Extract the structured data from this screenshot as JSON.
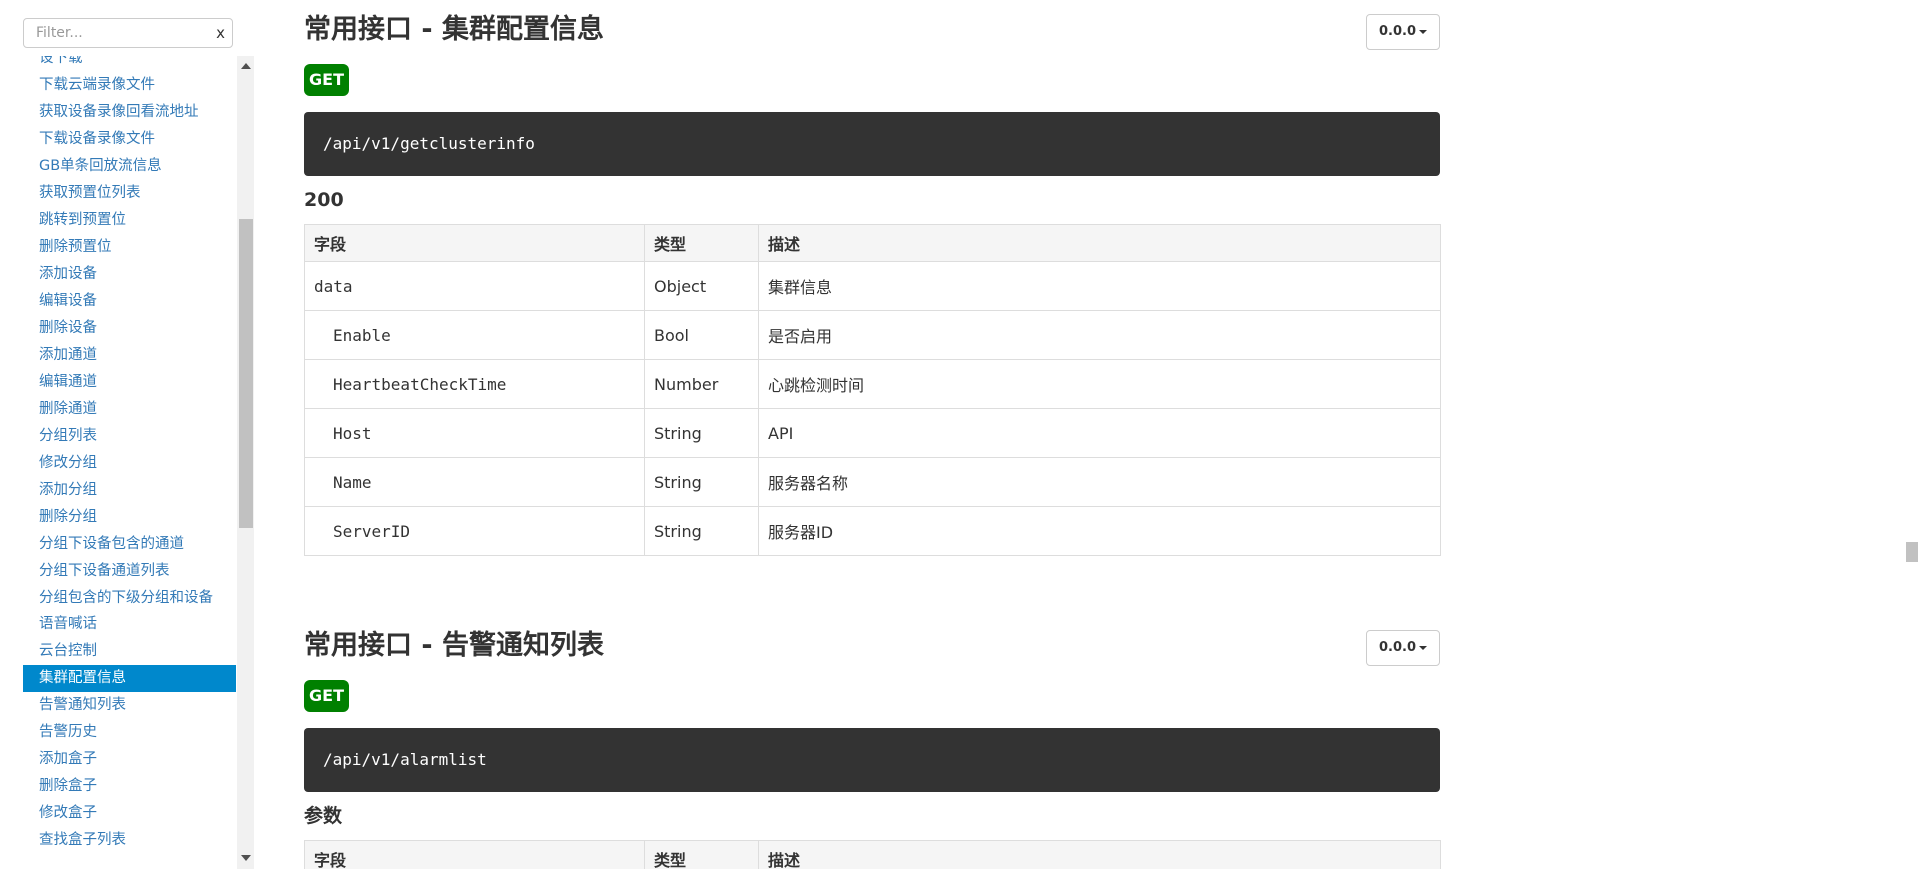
{
  "sidebar": {
    "filter": {
      "placeholder": "Filter...",
      "value": "",
      "clear_label": "x"
    },
    "items": [
      {
        "label": "设下载",
        "active": false
      },
      {
        "label": "下载云端录像文件",
        "active": false
      },
      {
        "label": "获取设备录像回看流地址",
        "active": false
      },
      {
        "label": "下载设备录像文件",
        "active": false
      },
      {
        "label": "GB单条回放流信息",
        "active": false
      },
      {
        "label": "获取预置位列表",
        "active": false
      },
      {
        "label": "跳转到预置位",
        "active": false
      },
      {
        "label": "删除预置位",
        "active": false
      },
      {
        "label": "添加设备",
        "active": false
      },
      {
        "label": "编辑设备",
        "active": false
      },
      {
        "label": "删除设备",
        "active": false
      },
      {
        "label": "添加通道",
        "active": false
      },
      {
        "label": "编辑通道",
        "active": false
      },
      {
        "label": "删除通道",
        "active": false
      },
      {
        "label": "分组列表",
        "active": false
      },
      {
        "label": "修改分组",
        "active": false
      },
      {
        "label": "添加分组",
        "active": false
      },
      {
        "label": "删除分组",
        "active": false
      },
      {
        "label": "分组下设备包含的通道",
        "active": false
      },
      {
        "label": "分组下设备通道列表",
        "active": false
      },
      {
        "label": "分组包含的下级分组和设备",
        "active": false
      },
      {
        "label": "语音喊话",
        "active": false
      },
      {
        "label": "云台控制",
        "active": false
      },
      {
        "label": "集群配置信息",
        "active": true
      },
      {
        "label": "告警通知列表",
        "active": false
      },
      {
        "label": "告警历史",
        "active": false
      },
      {
        "label": "添加盒子",
        "active": false
      },
      {
        "label": "删除盒子",
        "active": false
      },
      {
        "label": "修改盒子",
        "active": false
      },
      {
        "label": "查找盒子列表",
        "active": false
      }
    ]
  },
  "sections": [
    {
      "title": "常用接口 - 集群配置信息",
      "version": "0.0.0",
      "method": "GET",
      "endpoint": "/api/v1/getclusterinfo",
      "subheading": "200",
      "columns": [
        "字段",
        "类型",
        "描述"
      ],
      "rows": [
        {
          "field": "data",
          "type": "Object",
          "desc": "集群信息",
          "nested": false
        },
        {
          "field": "Enable",
          "type": "Bool",
          "desc": "是否启用",
          "nested": true
        },
        {
          "field": "HeartbeatCheckTime",
          "type": "Number",
          "desc": "心跳检测时间",
          "nested": true
        },
        {
          "field": "Host",
          "type": "String",
          "desc": "API",
          "nested": true
        },
        {
          "field": "Name",
          "type": "String",
          "desc": "服务器名称",
          "nested": true
        },
        {
          "field": "ServerID",
          "type": "String",
          "desc": "服务器ID",
          "nested": true
        }
      ]
    },
    {
      "title": "常用接口 - 告警通知列表",
      "version": "0.0.0",
      "method": "GET",
      "endpoint": "/api/v1/alarmlist",
      "subheading": "参数",
      "columns": [
        "字段",
        "类型",
        "描述"
      ],
      "rows": []
    }
  ],
  "colors": {
    "link": "#337ab7",
    "active_bg": "#0088cc",
    "get_badge": "#008000",
    "endpoint_bg": "#333333"
  },
  "icons": {
    "filter_clear": "close-icon",
    "version_caret": "caret-down-icon"
  }
}
